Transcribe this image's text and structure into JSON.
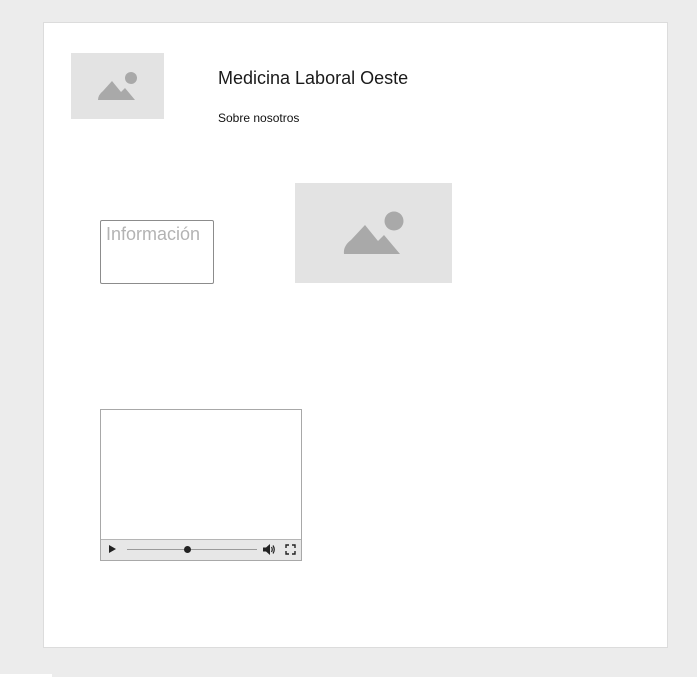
{
  "header": {
    "site_title": "Medicina Laboral Oeste",
    "nav_link": "Sobre nosotros"
  },
  "content": {
    "info_button_text": "Información"
  },
  "video": {
    "progress_fraction": 0.46
  },
  "icons": {
    "logo": "image-placeholder-icon",
    "hero": "image-placeholder-icon",
    "play": "play-icon",
    "volume": "volume-icon",
    "fullscreen": "fullscreen-icon"
  },
  "colors": {
    "page_background": "#ececec",
    "card_background": "#ffffff",
    "placeholder_fill": "#e3e3e3",
    "placeholder_icon": "#a9a9a9",
    "info_text": "#b3b3b3"
  }
}
